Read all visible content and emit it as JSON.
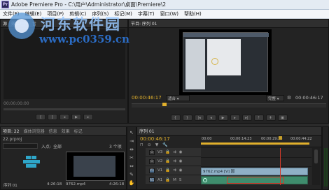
{
  "window": {
    "title": "Adobe Premiere Pro - C:\\用户\\Administrator\\桌面\\Premiere\\2"
  },
  "menu": [
    "文件(F)",
    "编辑(E)",
    "项目(P)",
    "剪辑(C)",
    "序列(S)",
    "标记(M)",
    "字幕(T)",
    "窗口(W)",
    "帮助(H)"
  ],
  "source_panel": {
    "tabs": [
      "源",
      "效果控件",
      "音"
    ],
    "timecode": "00:00:00:00"
  },
  "program_panel": {
    "tab": "节目: 序列 01",
    "timecode": "00:00:46:17",
    "fit": "适合",
    "resolution": "完整",
    "duration": "00:00:46:17"
  },
  "project_panel": {
    "tabs": [
      "项目: 22",
      "媒体浏览器",
      "信息",
      "效果",
      "标记"
    ],
    "file": "22.prproj",
    "entry_label": "入点:",
    "entry_value": "全部",
    "count": "3 个项",
    "items": [
      {
        "name": "序列 01",
        "duration": "4:26:18"
      },
      {
        "name": "9762.mp4",
        "duration": "4:26:18"
      }
    ]
  },
  "timeline": {
    "tab": "序列 01",
    "timecode": "00:00:46:17",
    "ruler": [
      "00:00",
      "00:00:14:23",
      "00:00:29:23",
      "00:00:44:22"
    ],
    "tracks": [
      {
        "name": "V3"
      },
      {
        "name": "V2"
      },
      {
        "name": "V1",
        "clip": "9762.mp4 [V] 圆"
      },
      {
        "name": "A1",
        "clip": ""
      }
    ]
  },
  "watermark": {
    "title": "河东软件园",
    "url": "www.pc0359.cn"
  },
  "colors": {
    "accent": "#e1b02c",
    "video_clip": "#8fb0c6",
    "audio_clip": "#3f8d6d",
    "playhead": "#d23a2a"
  }
}
